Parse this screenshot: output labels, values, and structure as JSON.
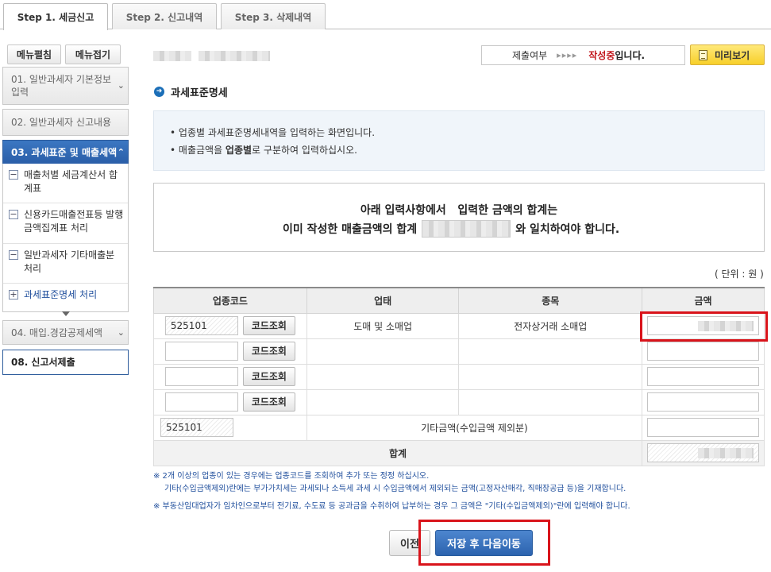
{
  "tabs": [
    {
      "label": "Step 1. 세금신고",
      "active": true
    },
    {
      "label": "Step 2. 신고내역",
      "active": false
    },
    {
      "label": "Step 3. 삭제내역",
      "active": false
    }
  ],
  "sidebar": {
    "expand_label": "메뉴펼침",
    "collapse_label": "메뉴접기",
    "items": [
      {
        "label": "01. 일반과세자 기본정보 입력"
      },
      {
        "label": "02. 일반과세자 신고내용"
      },
      {
        "label": "03. 과세표준 및 매출세액"
      },
      {
        "label": "04. 매입.경감공제세액"
      },
      {
        "label": "08. 신고서제출"
      }
    ],
    "subitems": [
      {
        "label": "매출처별 세금계산서 합계표",
        "icon": "−"
      },
      {
        "label": "신용카드매출전표등 발행금액집계표 처리",
        "icon": "−"
      },
      {
        "label": "일반과세자 기타매출분 처리",
        "icon": "−"
      },
      {
        "label": "과세표준명세 처리",
        "icon": "+"
      }
    ]
  },
  "status": {
    "label": "제출여부",
    "arrows": "▸▸▸▸",
    "state_prefix": "작성중",
    "state_suffix": "입니다."
  },
  "preview_label": "미리보기",
  "section_title": "과세표준명세",
  "info": {
    "line1": "업종별 과세표준명세내역을 입력하는 화면입니다.",
    "line2_pre": "매출금액을 ",
    "line2_bold": "업종별",
    "line2_post": "로 구분하여 입력하십시오."
  },
  "notice": {
    "line1": "아래 입력사항에서   입력한 금액의 합계는",
    "line2_pre": "이미 작성한 매출금액의 합계",
    "line2_post": "와 일치하여야 합니다."
  },
  "unit_label": "( 단위 : 원 )",
  "table": {
    "headers": [
      "업종코드",
      "업태",
      "종목",
      "금액"
    ],
    "code_button_label": "코드조회",
    "rows": [
      {
        "code": "525101",
        "business_type": "도매 및 소매업",
        "item": "전자상거래 소매업"
      },
      {
        "code": "",
        "business_type": "",
        "item": ""
      },
      {
        "code": "",
        "business_type": "",
        "item": ""
      },
      {
        "code": "",
        "business_type": "",
        "item": ""
      }
    ],
    "other_row": {
      "code": "525101",
      "label": "기타금액(수입금액 제외분)"
    },
    "total_label": "합계"
  },
  "notes": {
    "n1": "※ 2개 이상의 업종이 있는 경우에는 업종코드를 조회하여 추가 또는 정정 하십시오.",
    "n1b": "기타(수입금액제외)란에는 부가가치세는 과세되나 소득세 과세 시 수입금액에서 제외되는 금액(고정자산매각, 직매장공급 등)을 기재합니다.",
    "n2": "※ 부동산임대업자가 임차인으로부터 전기료, 수도료 등 공과금을 수취하여 납부하는 경우 그 금액은 \"기타(수입금액제외)\"란에 입력해야 합니다."
  },
  "buttons": {
    "prev": "이전",
    "save_next": "저장 후 다음이동"
  }
}
